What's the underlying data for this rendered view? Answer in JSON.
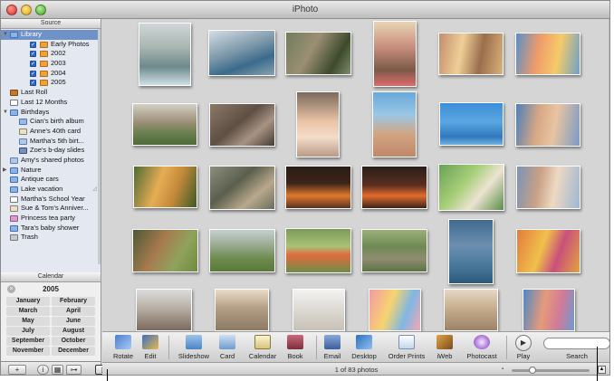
{
  "window": {
    "title": "iPhoto"
  },
  "source": {
    "header": "Source",
    "items": [
      {
        "label": "Library",
        "icon": "library-icon",
        "selected": true
      },
      {
        "label": "Early Photos",
        "icon": "folder-icon"
      },
      {
        "label": "2002",
        "icon": "folder-icon"
      },
      {
        "label": "2003",
        "icon": "folder-icon"
      },
      {
        "label": "2004",
        "icon": "folder-icon"
      },
      {
        "label": "2005",
        "icon": "folder-icon"
      },
      {
        "label": "Last Roll",
        "icon": "film-roll-icon"
      },
      {
        "label": "Last 12 Months",
        "icon": "calendar-icon"
      },
      {
        "label": "Birthdays",
        "icon": "folder-icon"
      },
      {
        "label": "Cian's birth album",
        "icon": "book-icon"
      },
      {
        "label": "Anne's 40th card",
        "icon": "card-icon"
      },
      {
        "label": "Martha's 5th birt...",
        "icon": "smart-album-icon"
      },
      {
        "label": "Zoe's b-day slides",
        "icon": "slideshow-icon"
      },
      {
        "label": "Amy's shared photos",
        "icon": "shared-album-icon"
      },
      {
        "label": "Nature",
        "icon": "folder-icon"
      },
      {
        "label": "Antique cars",
        "icon": "album-icon"
      },
      {
        "label": "Lake vacation",
        "icon": "album-icon"
      },
      {
        "label": "Martha's School Year",
        "icon": "calendar-icon"
      },
      {
        "label": "Sue & Tom's Anniver...",
        "icon": "card-icon"
      },
      {
        "label": "Princess tea party",
        "icon": "pink-album-icon"
      },
      {
        "label": "Tara's baby shower",
        "icon": "album-icon"
      },
      {
        "label": "Trash",
        "icon": "trash-icon"
      }
    ]
  },
  "calendar": {
    "header": "Calendar",
    "year": "2005",
    "months": [
      "January",
      "February",
      "March",
      "April",
      "May",
      "June",
      "July",
      "August",
      "September",
      "October",
      "November",
      "December"
    ]
  },
  "sidebar_buttons": {
    "add": "+",
    "info": "i"
  },
  "toolbar": {
    "tools": [
      {
        "label": "Rotate",
        "icon": "rotate-icon"
      },
      {
        "label": "Edit",
        "icon": "edit-icon"
      },
      {
        "label": "Slideshow",
        "icon": "slideshow-icon"
      },
      {
        "label": "Card",
        "icon": "card-icon"
      },
      {
        "label": "Calendar",
        "icon": "calendar-icon"
      },
      {
        "label": "Book",
        "icon": "book-icon"
      },
      {
        "label": "Email",
        "icon": "email-icon"
      },
      {
        "label": "Desktop",
        "icon": "desktop-icon"
      },
      {
        "label": "Order Prints",
        "icon": "order-prints-icon"
      },
      {
        "label": "iWeb",
        "icon": "iweb-icon"
      },
      {
        "label": "Photocast",
        "icon": "photocast-icon"
      },
      {
        "label": "Play",
        "icon": "play-icon"
      }
    ],
    "search_label": "Search"
  },
  "status": {
    "photo_count": "1 of 83 photos"
  },
  "colors": {
    "selection": "#6f92c7",
    "grid_bg": "#d5d5d5",
    "sidebar_bg": "#e4e9f1"
  }
}
